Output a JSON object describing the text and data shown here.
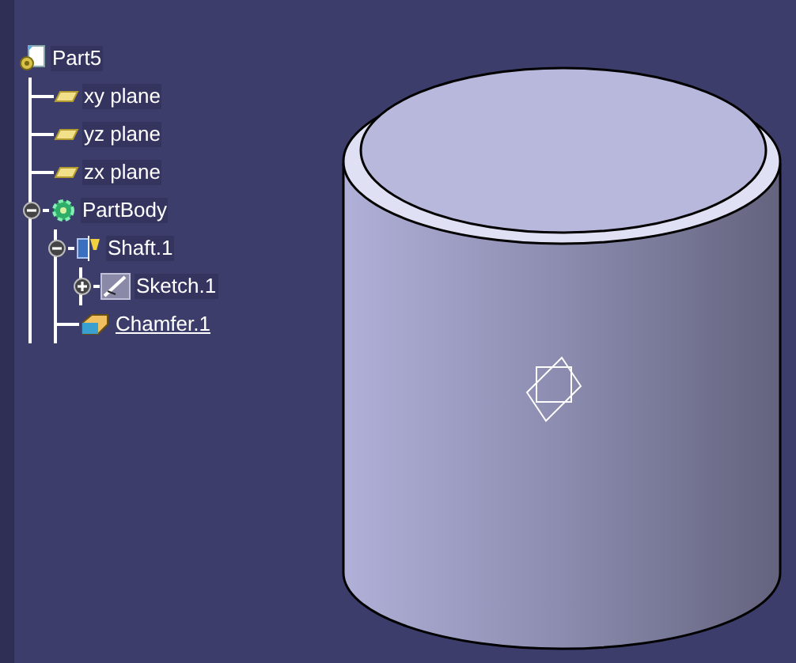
{
  "tree": {
    "label": "Part5",
    "kind": "part",
    "selected": false,
    "children": [
      {
        "label": "xy plane",
        "kind": "plane",
        "selected": false
      },
      {
        "label": "yz plane",
        "kind": "plane",
        "selected": false
      },
      {
        "label": "zx plane",
        "kind": "plane",
        "selected": false
      },
      {
        "label": "PartBody",
        "kind": "body",
        "selected": false,
        "expanded": true,
        "children": [
          {
            "label": "Shaft.1",
            "kind": "shaft",
            "selected": false,
            "expanded": true,
            "children": [
              {
                "label": "Sketch.1",
                "kind": "sketch",
                "selected": false,
                "expanded": false
              }
            ]
          },
          {
            "label": "Chamfer.1",
            "kind": "chamfer",
            "selected": true
          }
        ]
      }
    ]
  }
}
